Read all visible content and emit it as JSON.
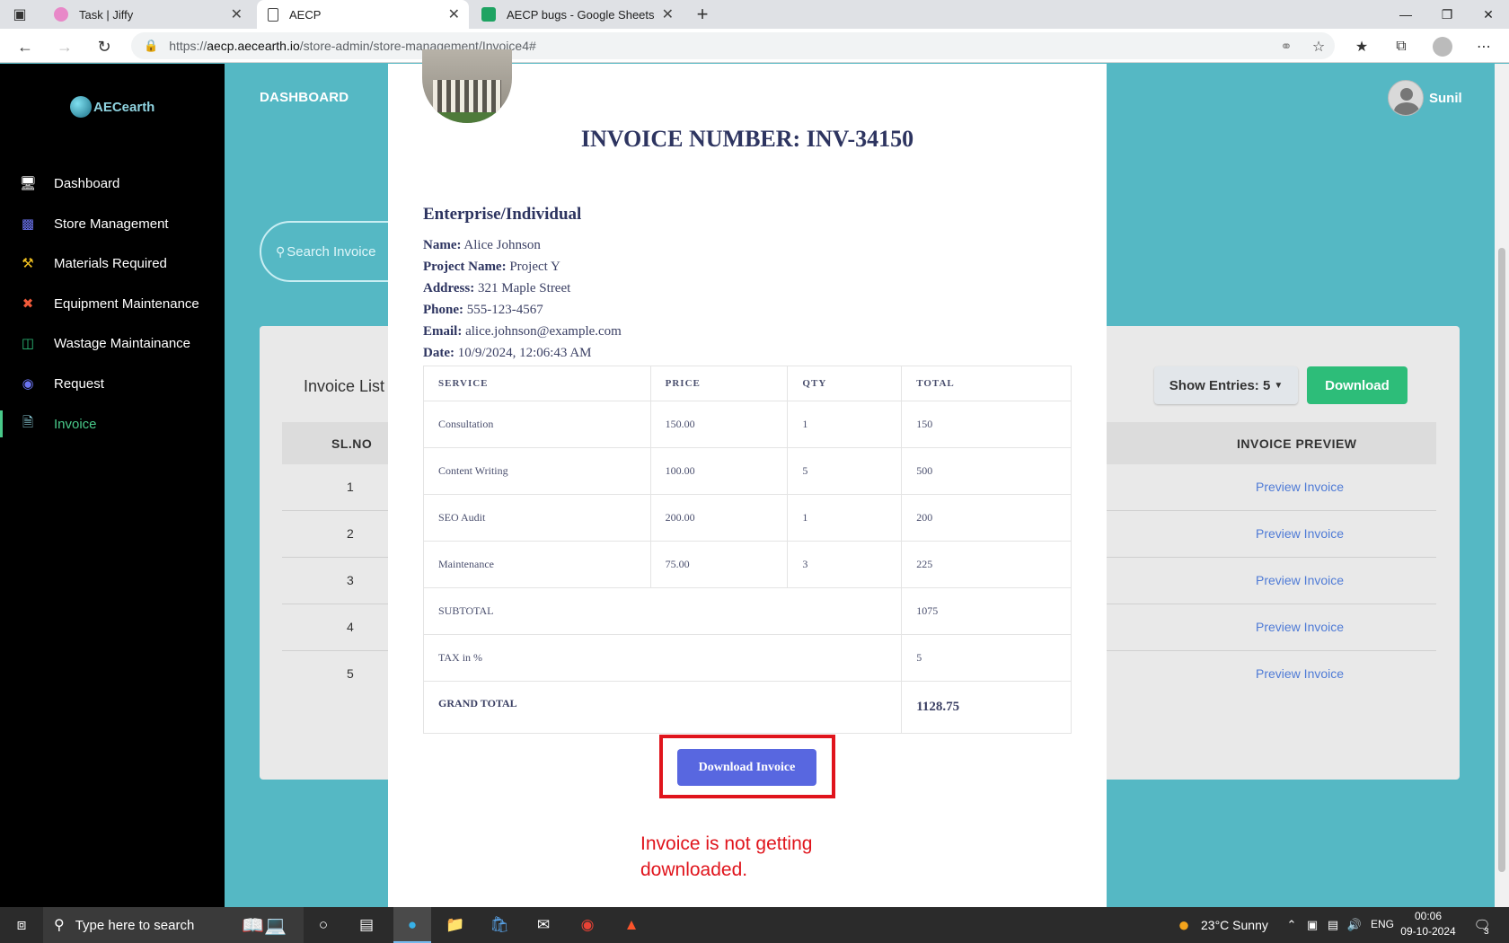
{
  "browser": {
    "tabs": [
      {
        "title": "Task | Jiffy"
      },
      {
        "title": "AECP"
      },
      {
        "title": "AECP bugs - Google Sheets"
      }
    ],
    "url_prefix": "https://",
    "url_host": "aecp.aecearth.io",
    "url_path": "/store-admin/store-management/Invoice4#"
  },
  "sidebar": {
    "logo_text": "AECearth",
    "items": [
      {
        "label": "Dashboard",
        "icon": "monitor-icon"
      },
      {
        "label": "Store Management",
        "icon": "store-icon"
      },
      {
        "label": "Materials Required",
        "icon": "hammer-icon"
      },
      {
        "label": "Equipment Maintenance",
        "icon": "tools-icon"
      },
      {
        "label": "Wastage Maintainance",
        "icon": "trash-icon"
      },
      {
        "label": "Request",
        "icon": "request-icon"
      },
      {
        "label": "Invoice",
        "icon": "document-icon"
      }
    ]
  },
  "header": {
    "title": "DASHBOARD",
    "user_name": "Sunil"
  },
  "search": {
    "placeholder": "Search Invoice"
  },
  "invoice_list": {
    "title": "Invoice List",
    "show_entries": "Show Entries: 5",
    "download_label": "Download",
    "col_slno": "SL.NO",
    "col_preview": "INVOICE PREVIEW",
    "rows": [
      {
        "no": "1",
        "preview": "Preview Invoice"
      },
      {
        "no": "2",
        "preview": "Preview Invoice"
      },
      {
        "no": "3",
        "preview": "Preview Invoice"
      },
      {
        "no": "4",
        "preview": "Preview Invoice"
      },
      {
        "no": "5",
        "preview": "Preview Invoice"
      }
    ]
  },
  "modal": {
    "invoice_number": "INVOICE NUMBER: INV-34150",
    "section_title": "Enterprise/Individual",
    "fields": [
      {
        "label": "Name:",
        "value": "Alice Johnson"
      },
      {
        "label": "Project Name:",
        "value": "Project Y"
      },
      {
        "label": "Address:",
        "value": "321 Maple Street"
      },
      {
        "label": "Phone:",
        "value": "555-123-4567"
      },
      {
        "label": "Email:",
        "value": "alice.johnson@example.com"
      },
      {
        "label": "Date:",
        "value": "10/9/2024, 12:06:43 AM"
      }
    ],
    "table_headers": [
      "SERVICE",
      "PRICE",
      "QTY",
      "TOTAL"
    ],
    "items": [
      {
        "service": "Consultation",
        "price": "150.00",
        "qty": "1",
        "total": "150"
      },
      {
        "service": "Content Writing",
        "price": "100.00",
        "qty": "5",
        "total": "500"
      },
      {
        "service": "SEO Audit",
        "price": "200.00",
        "qty": "1",
        "total": "200"
      },
      {
        "service": "Maintenance",
        "price": "75.00",
        "qty": "3",
        "total": "225"
      }
    ],
    "subtotal_label": "SUBTOTAL",
    "subtotal_value": "1075",
    "tax_label": "TAX in %",
    "tax_value": "5",
    "grand_total_label": "GRAND TOTAL",
    "grand_total_value": "1128.75",
    "download_invoice_label": "Download Invoice"
  },
  "annotation": {
    "line1": "Invoice is not getting",
    "line2": "downloaded."
  },
  "taskbar": {
    "search_placeholder": "Type here to search",
    "weather": "23°C  Sunny",
    "language": "ENG",
    "time": "00:06",
    "date": "09-10-2024",
    "notification_count": "3"
  },
  "colors": {
    "teal_background": "#55b8c4",
    "sidebar_bg": "#000000",
    "active_green": "#49c98a",
    "download_green": "#2dbd79",
    "download_invoice_blue": "#5867e0",
    "annotation_red": "#e0141c"
  }
}
